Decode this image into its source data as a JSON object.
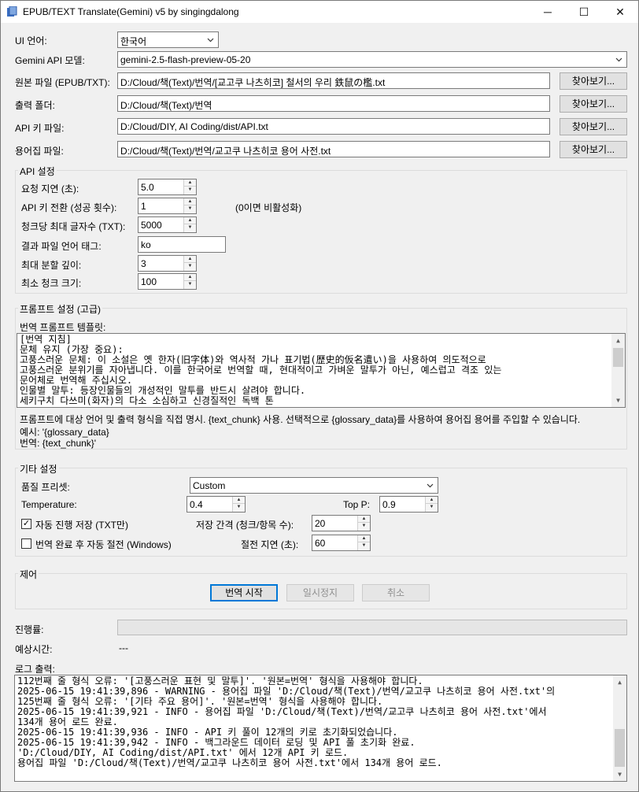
{
  "window": {
    "title": "EPUB/TEXT Translate(Gemini) v5 by singingdalong",
    "minimize": "─",
    "maximize": "☐",
    "close": "✕"
  },
  "top": {
    "ui_lang_label": "UI 언어:",
    "ui_lang_value": "한국어",
    "model_label": "Gemini API 모델:",
    "model_value": "gemini-2.5-flash-preview-05-20",
    "source_label": "원본 파일 (EPUB/TXT):",
    "source_value": "D:/Cloud/책(Text)/번역/[교고쿠 나츠히코] 철서의 우리 鉄鼠の檻.txt",
    "output_label": "출력 폴더:",
    "output_value": "D:/Cloud/책(Text)/번역",
    "apikey_label": "API 키 파일:",
    "apikey_value": "D:/Cloud/DIY, AI Coding/dist/API.txt",
    "glossary_label": "용어집 파일:",
    "glossary_value": "D:/Cloud/책(Text)/번역/교고쿠 나츠히코 용어 사전.txt",
    "browse_label": "찾아보기..."
  },
  "api": {
    "title": "API 설정",
    "delay_label": "요청 지연 (초):",
    "delay_value": "5.0",
    "switch_label": "API 키 전환 (성공 횟수):",
    "switch_value": "1",
    "switch_hint": "(0이면 비활성화)",
    "maxchars_label": "청크당 최대 글자수 (TXT):",
    "maxchars_value": "5000",
    "langtag_label": "결과 파일 언어 태그:",
    "langtag_value": "ko",
    "depth_label": "최대 분할 깊이:",
    "depth_value": "3",
    "minchunk_label": "최소 청크 크기:",
    "minchunk_value": "100"
  },
  "prompt": {
    "title": "프롬프트 설정 (고급)",
    "template_label": "번역 프롬프트 템플릿:",
    "lines": [
      "[번역 지침]",
      "문체 유지 (가장 중요):",
      "고풍스러운 문체: 이 소설은 옛 한자(旧字体)와 역사적 가나 표기법(歴史的仮名遣い)을 사용하여 의도적으로",
      "고풍스러운 분위기를 자아냅니다. 이를 한국어로 번역할 때, 현대적이고 가벼운 말투가 아닌, 예스럽고 격조 있는",
      "문어체로 번역해 주십시오.",
      "인물별 말투: 등장인물들의 개성적인 말투를 반드시 살려야 합니다.",
      "세키구치 다쓰미(화자)의 다소 소심하고 신경질적인 독백 톤"
    ],
    "hint1": "프롬프트에 대상 언어 및 출력 형식을 직접 명시. {text_chunk} 사용. 선택적으로 {glossary_data}를 사용하여 용어집 용어를 주입할 수 있습니다.",
    "hint2": "예시: '{glossary_data}",
    "hint3": "번역: {text_chunk}'"
  },
  "other": {
    "title": "기타 설정",
    "preset_label": "품질 프리셋:",
    "preset_value": "Custom",
    "temp_label": "Temperature:",
    "temp_value": "0.4",
    "topp_label": "Top P:",
    "topp_value": "0.9",
    "autosave_label": "자동 진행 저장 (TXT만)",
    "autosave_checked": true,
    "interval_label": "저장 간격 (청크/항목 수):",
    "interval_value": "20",
    "shutdown_label": "번역 완료 후 자동 절전 (Windows)",
    "shutdown_checked": false,
    "sleepdelay_label": "절전 지연 (초):",
    "sleepdelay_value": "60"
  },
  "control": {
    "title": "제어",
    "start": "번역 시작",
    "pause": "일시정지",
    "cancel": "취소"
  },
  "status": {
    "progress_label": "진행률:",
    "progress_fraction": 0,
    "eta_label": "예상시간:",
    "eta_value": "---",
    "log_label": "로그 출력:"
  },
  "log": [
    "112번째 줄 형식 오류: '[고풍스러운 표현 및 말투]'. '원본=번역' 형식을 사용해야 합니다.",
    "2025-06-15 19:41:39,896 - WARNING - 용어집 파일 'D:/Cloud/책(Text)/번역/교고쿠 나츠히코 용어 사전.txt'의",
    "125번째 줄 형식 오류: '[기타 주요 용어]'. '원본=번역' 형식을 사용해야 합니다.",
    "2025-06-15 19:41:39,921 - INFO - 용어집 파일 'D:/Cloud/책(Text)/번역/교고쿠 나츠히코 용어 사전.txt'에서",
    "134개 용어 로드 완료.",
    "2025-06-15 19:41:39,936 - INFO - API 키 풀이 12개의 키로 초기화되었습니다.",
    "2025-06-15 19:41:39,942 - INFO - 백그라운드 데이터 로딩 및 API 풀 초기화 완료.",
    "'D:/Cloud/DIY, AI Coding/dist/API.txt' 에서 12개 API 키 로드.",
    "용어집 파일 'D:/Cloud/책(Text)/번역/교고쿠 나츠히코 용어 사전.txt'에서 134개 용어 로드."
  ]
}
